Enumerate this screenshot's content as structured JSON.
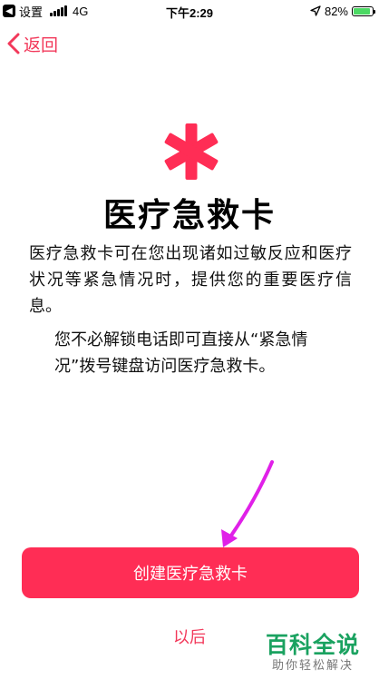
{
  "status_bar": {
    "app_name": "设置",
    "network": "4G",
    "time": "下午2:29",
    "battery_percent": "82%",
    "battery_level": 0.82
  },
  "nav": {
    "back_label": "返回"
  },
  "main": {
    "title": "医疗急救卡",
    "description": "医疗急救卡可在您出现诸如过敏反应和医疗状况等紧急情况时，提供您的重要医疗信息。",
    "description_2": "您不必解锁电话即可直接从“紧急情况”拨号键盘访问医疗急救卡。"
  },
  "actions": {
    "create_label": "创建医疗急救卡",
    "later_label": "以后"
  },
  "watermark": {
    "main": "百科全说",
    "sub": "助你轻松解决"
  },
  "colors": {
    "accent": "#ff2d55",
    "link": "#f2385a",
    "arrow": "#e020e8",
    "watermark": "#1aa260"
  },
  "icons": [
    "back-app-icon",
    "signal-icon",
    "location-icon",
    "battery-icon",
    "chevron-left-icon",
    "medical-asterisk-icon",
    "pointer-arrow-icon"
  ]
}
